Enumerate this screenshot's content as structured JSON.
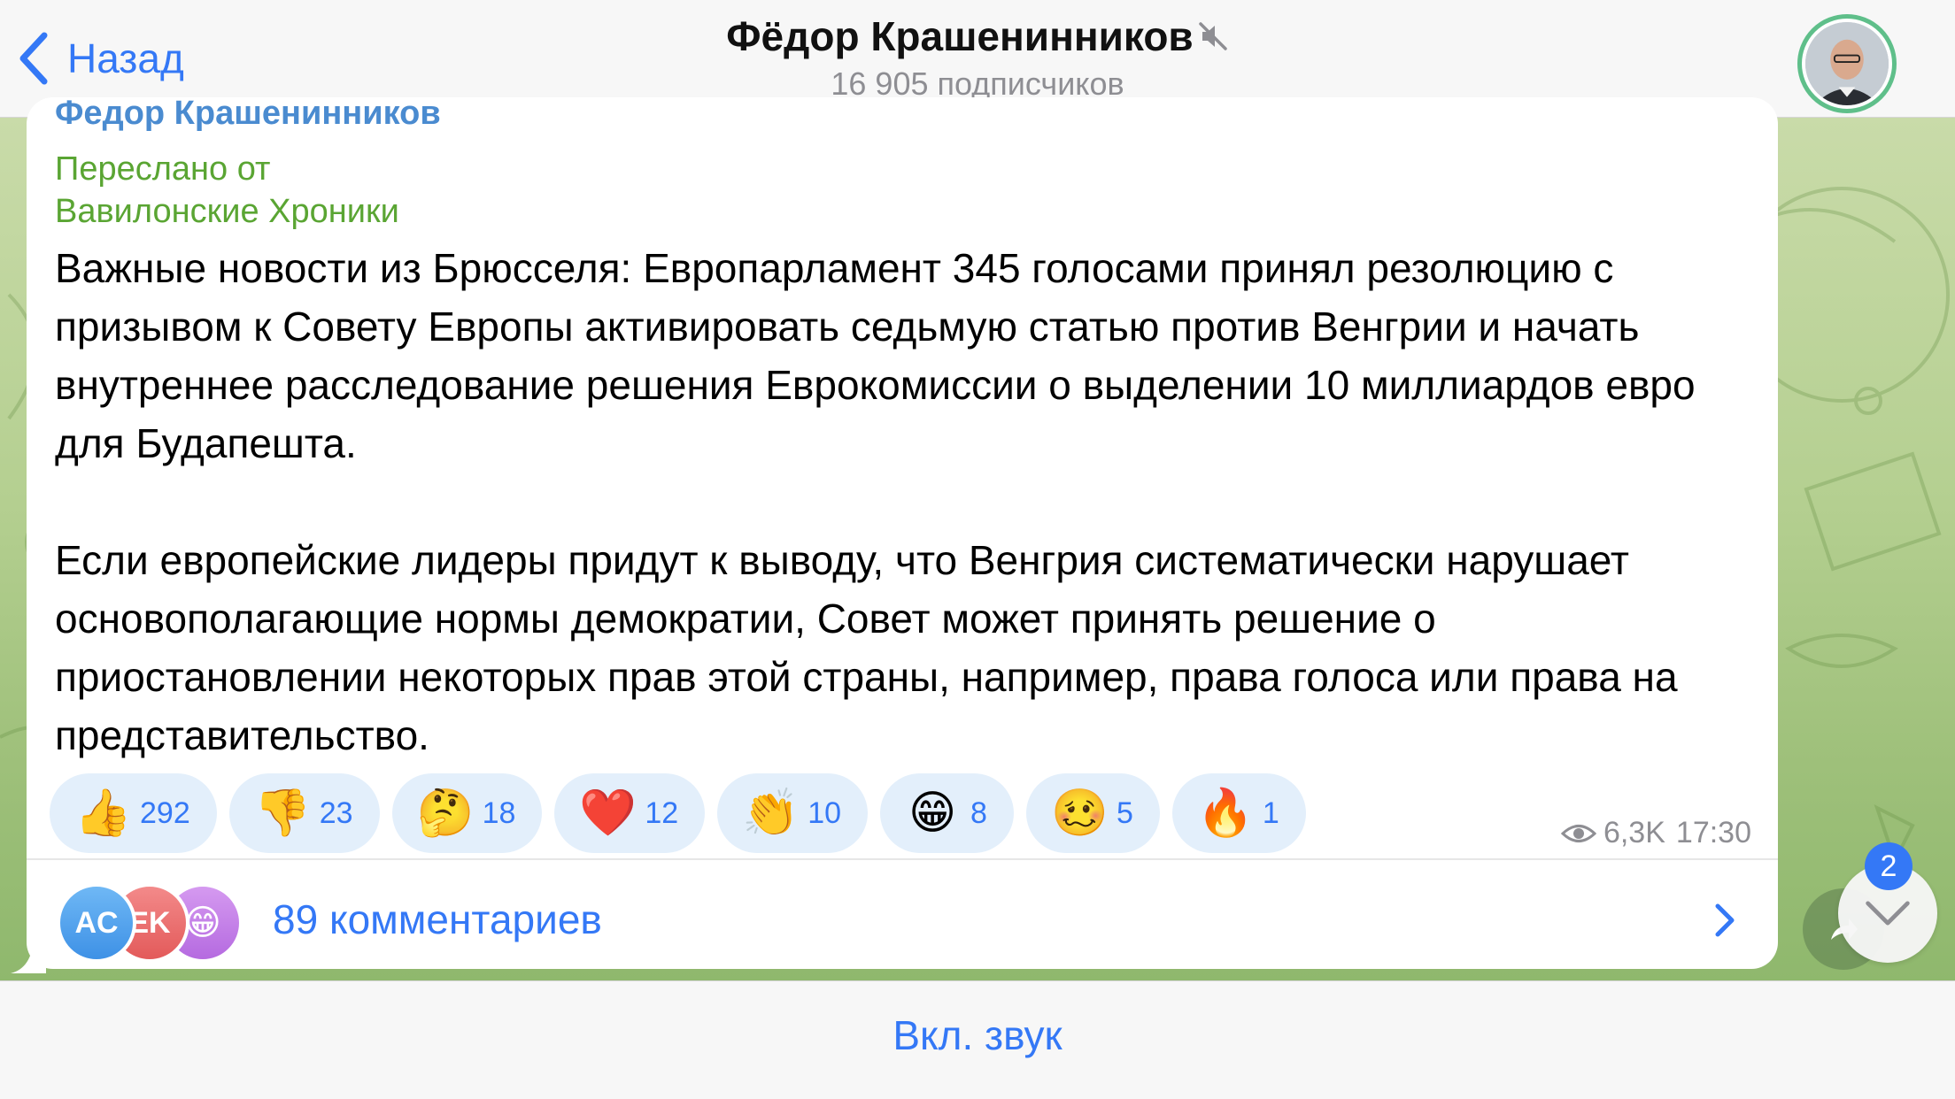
{
  "header": {
    "back_label": "Назад",
    "title": "Фёдор Крашенинников",
    "subtitle": "16 905 подписчиков"
  },
  "message": {
    "sender": "Федор Крашенинников",
    "forwarded_label": "Переслано от",
    "forwarded_source": "Вавилонские Хроники",
    "paragraphs": [
      "Важные новости из Брюсселя: Европарламент 345 голосами принял резолюцию с призывом к Совету Европы активировать седьмую статью против Венгрии и начать внутреннее расследование решения Еврокомиссии о выделении 10 миллиардов евро для Будапешта.",
      "Если европейские лидеры придут к выводу, что Венгрия систематически нарушает основополагающие нормы демократии, Совет может принять решение о приостановлении некоторых прав этой страны, например, права голоса или права на представительство."
    ],
    "reactions": [
      {
        "emoji": "👍",
        "count": "292"
      },
      {
        "emoji": "👎",
        "count": "23"
      },
      {
        "emoji": "🤔",
        "count": "18"
      },
      {
        "emoji": "❤️",
        "count": "12"
      },
      {
        "emoji": "👏",
        "count": "10"
      },
      {
        "emoji": "😁",
        "count": "8"
      },
      {
        "emoji": "🥴",
        "count": "5"
      },
      {
        "emoji": "🔥",
        "count": "1"
      }
    ],
    "views": "6,3K",
    "time": "17:30",
    "commenters": [
      "AC",
      "EK",
      "😁"
    ],
    "comments_label": "89 комментариев"
  },
  "scroll": {
    "unread_count": "2"
  },
  "bottom": {
    "unmute_label": "Вкл. звук"
  },
  "colors": {
    "accent": "#3478f6",
    "forward_green": "#5aa533",
    "sender_blue": "#4a8bd0",
    "reaction_bg": "#e3effb"
  }
}
